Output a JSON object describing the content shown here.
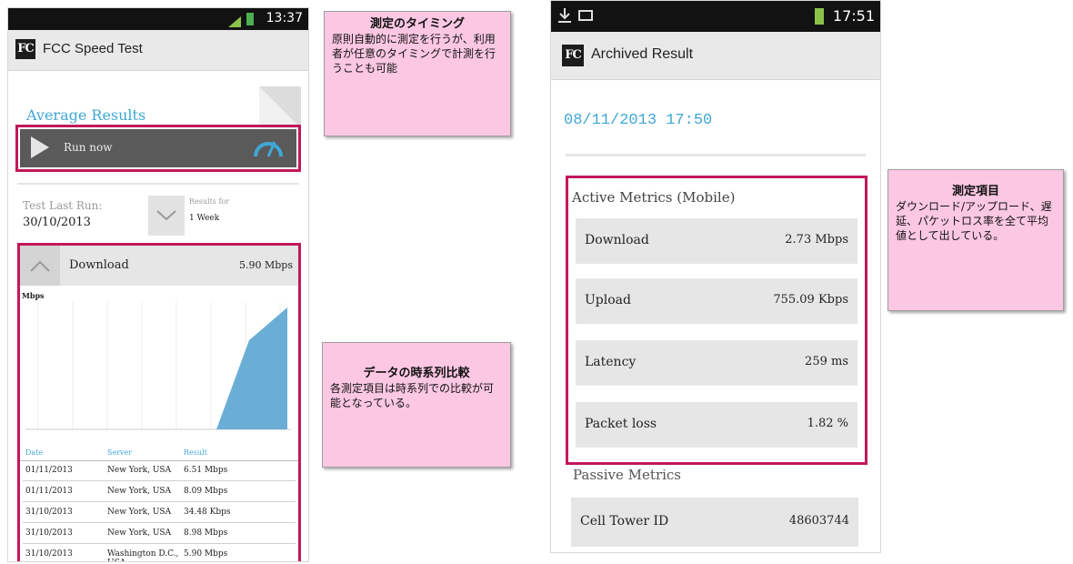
{
  "left_phone": {
    "status_time": "13:37",
    "app_title": "FCC Speed Test",
    "logo_text": "FC",
    "section_title": "Average Results",
    "run_now_label": "Run now",
    "last_run_label": "Test Last Run:",
    "last_run_date": "30/10/2013",
    "results_for_label": "Results for",
    "results_for_value": "1 Week",
    "download_label": "Download",
    "download_value": "5.90 Mbps",
    "chart_unit": "Mbps",
    "table_headers": [
      "Date",
      "Server",
      "Result"
    ],
    "table_rows": [
      {
        "date": "01/11/2013",
        "server": "New York, USA",
        "result": "6.51 Mbps"
      },
      {
        "date": "01/11/2013",
        "server": "New York, USA",
        "result": "8.09 Mbps"
      },
      {
        "date": "31/10/2013",
        "server": "New York, USA",
        "result": "34.48 Kbps"
      },
      {
        "date": "31/10/2013",
        "server": "New York, USA",
        "result": "8.98 Mbps"
      },
      {
        "date": "31/10/2013",
        "server": "Washington D.C., USA",
        "result": "5.90 Mbps"
      }
    ]
  },
  "right_phone": {
    "status_time": "17:51",
    "app_title": "Archived Result",
    "logo_text": "FC",
    "timestamp": "08/11/2013 17:50",
    "active_title": "Active Metrics (Mobile)",
    "metrics": [
      {
        "label": "Download",
        "value": "2.73 Mbps"
      },
      {
        "label": "Upload",
        "value": "755.09 Kbps"
      },
      {
        "label": "Latency",
        "value": "259 ms"
      },
      {
        "label": "Packet loss",
        "value": "1.82 %"
      }
    ],
    "passive_title": "Passive Metrics",
    "passive_metrics": [
      {
        "label": "Cell Tower ID",
        "value": "48603744"
      }
    ]
  },
  "notes": {
    "timing": {
      "title": "測定のタイミング",
      "body": "原則自動的に測定を行うが、利用者が任意のタイミングで計測を行うことも可能"
    },
    "timeseries": {
      "title": "データの時系列比較",
      "body": "各測定項目は時系列での比較が可能となっている。"
    },
    "items": {
      "title": "測定項目",
      "body": "ダウンロード/アップロード、遅延、パケットロス率を全て平均値として出している。"
    }
  },
  "colors": {
    "accent_blue": "#3fa7d6",
    "highlight": "#c2185b",
    "note_bg": "#fbc7e2",
    "chart_fill": "#6aaed6"
  }
}
